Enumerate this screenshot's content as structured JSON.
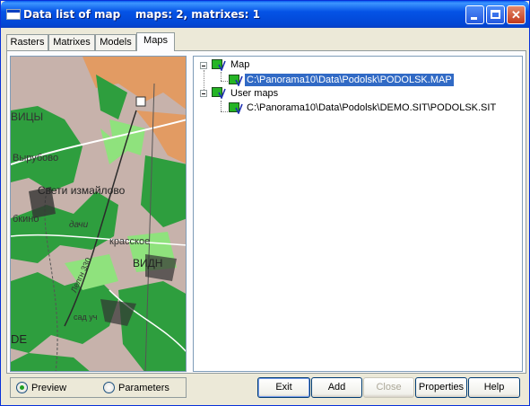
{
  "window": {
    "title": "Data list of map    maps: 2, matrixes: 1",
    "min_glyph": "",
    "close_glyph": "✕"
  },
  "tabs": [
    {
      "label": "Rasters",
      "active": false
    },
    {
      "label": "Matrixes",
      "active": false
    },
    {
      "label": "Models",
      "active": false
    },
    {
      "label": "Maps",
      "active": true
    }
  ],
  "tree": {
    "groups": [
      {
        "label": "Map",
        "expanded": true,
        "items": [
          {
            "label": "C:\\Panorama10\\Data\\Podolsk\\PODOLSK.MAP",
            "selected": true
          }
        ]
      },
      {
        "label": "User maps",
        "expanded": true,
        "items": [
          {
            "label": "C:\\Panorama10\\Data\\Podolsk\\DEMO.SIT\\PODOLSK.SIT",
            "selected": false
          }
        ]
      }
    ]
  },
  "map_preview": {
    "labels": [
      "ВИЦЫ",
      "Вырубово",
      "Свети измайлово",
      "дачи",
      "бкино",
      "красское",
      "ВИДН",
      "сад уч",
      "DE",
      "Лелгн 330"
    ]
  },
  "mode": {
    "options": [
      {
        "label": "Preview",
        "checked": true
      },
      {
        "label": "Parameters",
        "checked": false
      }
    ]
  },
  "buttons": {
    "exit": "Exit",
    "add": "Add",
    "close": "Close",
    "properties": "Properties",
    "help": "Help"
  },
  "colors": {
    "titlebar": "#0453E6",
    "selection": "#316AC5",
    "map_green": "#2E9E3E",
    "map_light_green": "#8FE27D",
    "map_gray": "#B7ACA6",
    "map_orange": "#E29B63",
    "map_pink": "#D8B8B0"
  }
}
